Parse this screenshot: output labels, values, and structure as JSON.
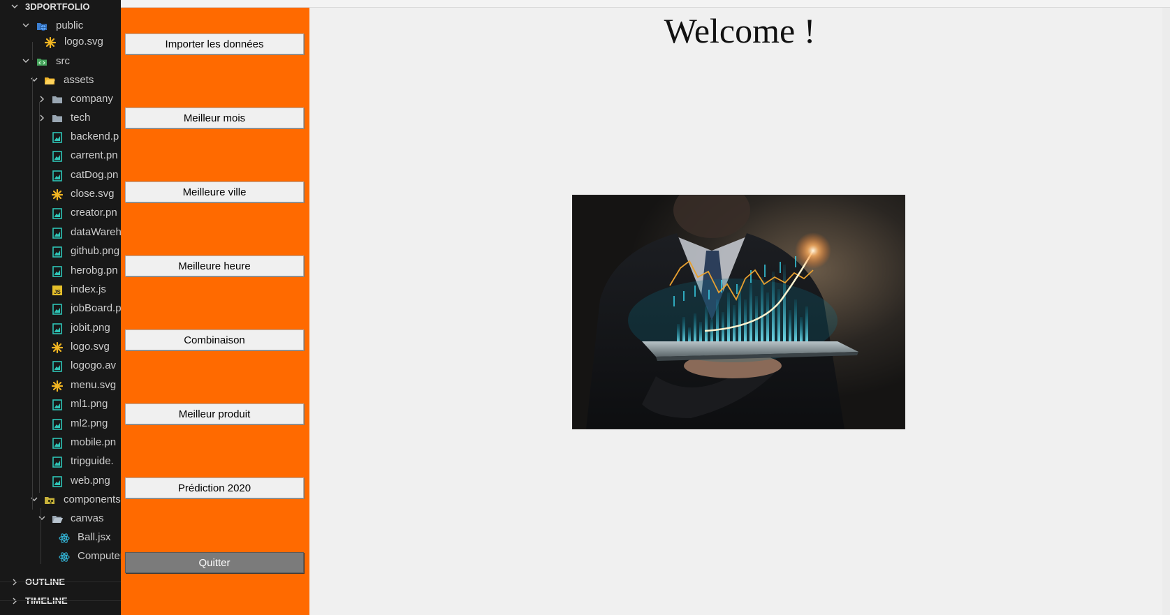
{
  "explorer": {
    "project": "3DPORTFOLIO",
    "items": [
      {
        "label": "public",
        "type": "folder-public",
        "expanded": true
      },
      {
        "label": "logo.svg",
        "type": "svg"
      },
      {
        "label": "src",
        "type": "folder-src",
        "expanded": true
      },
      {
        "label": "assets",
        "type": "folder-assets",
        "expanded": true
      },
      {
        "label": "company",
        "type": "folder",
        "expanded": false
      },
      {
        "label": "tech",
        "type": "folder",
        "expanded": false
      },
      {
        "label": "backend.p",
        "type": "image"
      },
      {
        "label": "carrent.pn",
        "type": "image"
      },
      {
        "label": "catDog.pn",
        "type": "image"
      },
      {
        "label": "close.svg",
        "type": "svg"
      },
      {
        "label": "creator.pn",
        "type": "image"
      },
      {
        "label": "dataWareh",
        "type": "image"
      },
      {
        "label": "github.png",
        "type": "image"
      },
      {
        "label": "herobg.pn",
        "type": "image"
      },
      {
        "label": "index.js",
        "type": "js"
      },
      {
        "label": "jobBoard.p",
        "type": "image"
      },
      {
        "label": "jobit.png",
        "type": "image"
      },
      {
        "label": "logo.svg",
        "type": "svg"
      },
      {
        "label": "logogo.av",
        "type": "image"
      },
      {
        "label": "menu.svg",
        "type": "svg"
      },
      {
        "label": "ml1.png",
        "type": "image"
      },
      {
        "label": "ml2.png",
        "type": "image"
      },
      {
        "label": "mobile.pn",
        "type": "image"
      },
      {
        "label": "tripguide.",
        "type": "image"
      },
      {
        "label": "web.png",
        "type": "image"
      },
      {
        "label": "components",
        "type": "folder-components",
        "expanded": true
      },
      {
        "label": "canvas",
        "type": "folder-open",
        "expanded": true
      },
      {
        "label": "Ball.jsx",
        "type": "react"
      },
      {
        "label": "Computers",
        "type": "react"
      }
    ],
    "sections": [
      "OUTLINE",
      "TIMELINE"
    ]
  },
  "sidebar": {
    "buttons": [
      "Importer les données",
      "Meilleur mois",
      "Meilleure ville",
      "Meilleure heure",
      "Combinaison",
      "Meilleur produit",
      "Prédiction 2020",
      "Quitter"
    ]
  },
  "main": {
    "title": "Welcome !",
    "image": "businessman-holding-tablet-with-holographic-stock-chart"
  },
  "colors": {
    "sidebar": "#ff6a00",
    "explorer_bg": "#181818",
    "main_bg": "#f0f0f0",
    "quit_button": "#7b7b7b",
    "svg_icon": "#f1b522",
    "image_icon": "#2ec4b6",
    "react_icon": "#33b4d6",
    "js_icon": "#e6c02a"
  }
}
